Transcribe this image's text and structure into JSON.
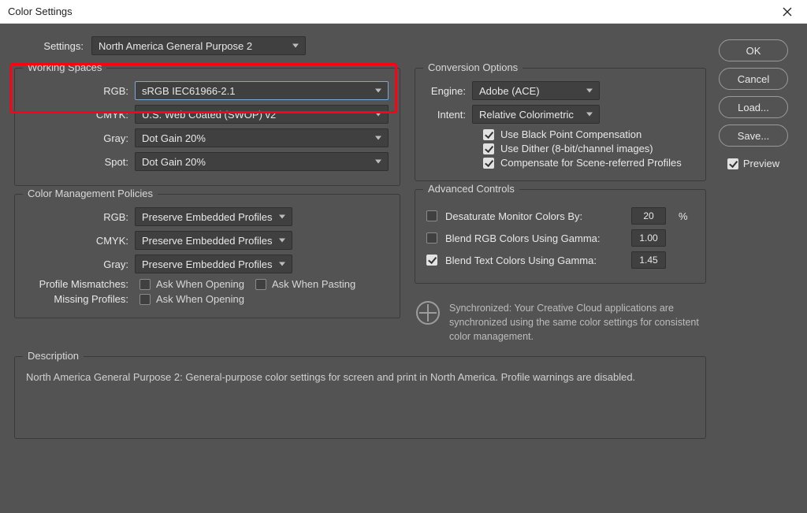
{
  "window": {
    "title": "Color Settings"
  },
  "settings": {
    "label": "Settings:",
    "value": "North America General Purpose 2"
  },
  "working_spaces": {
    "title": "Working Spaces",
    "rgb": {
      "label": "RGB:",
      "value": "sRGB IEC61966-2.1"
    },
    "cmyk": {
      "label": "CMYK:",
      "value": "U.S. Web Coated (SWOP) v2"
    },
    "gray": {
      "label": "Gray:",
      "value": "Dot Gain 20%"
    },
    "spot": {
      "label": "Spot:",
      "value": "Dot Gain 20%"
    }
  },
  "policies": {
    "title": "Color Management Policies",
    "rgb": {
      "label": "RGB:",
      "value": "Preserve Embedded Profiles"
    },
    "cmyk": {
      "label": "CMYK:",
      "value": "Preserve Embedded Profiles"
    },
    "gray": {
      "label": "Gray:",
      "value": "Preserve Embedded Profiles"
    },
    "profile_mismatches": {
      "label": "Profile Mismatches:",
      "opening": "Ask When Opening",
      "pasting": "Ask When Pasting"
    },
    "missing_profiles": {
      "label": "Missing Profiles:",
      "opening": "Ask When Opening"
    }
  },
  "conversion": {
    "title": "Conversion Options",
    "engine": {
      "label": "Engine:",
      "value": "Adobe (ACE)"
    },
    "intent": {
      "label": "Intent:",
      "value": "Relative Colorimetric"
    },
    "black_point": "Use Black Point Compensation",
    "dither": "Use Dither (8-bit/channel images)",
    "scene": "Compensate for Scene-referred Profiles"
  },
  "advanced": {
    "title": "Advanced Controls",
    "desaturate": {
      "label": "Desaturate Monitor Colors By:",
      "value": "20",
      "unit": "%"
    },
    "blend_rgb": {
      "label": "Blend RGB Colors Using Gamma:",
      "value": "1.00"
    },
    "blend_text": {
      "label": "Blend Text Colors Using Gamma:",
      "value": "1.45"
    }
  },
  "sync_text": "Synchronized: Your Creative Cloud applications are synchronized using the same color settings for consistent color management.",
  "description": {
    "title": "Description",
    "text": "North America General Purpose 2:  General-purpose color settings for screen and print in North America. Profile warnings are disabled."
  },
  "buttons": {
    "ok": "OK",
    "cancel": "Cancel",
    "load": "Load...",
    "save": "Save...",
    "preview": "Preview"
  }
}
